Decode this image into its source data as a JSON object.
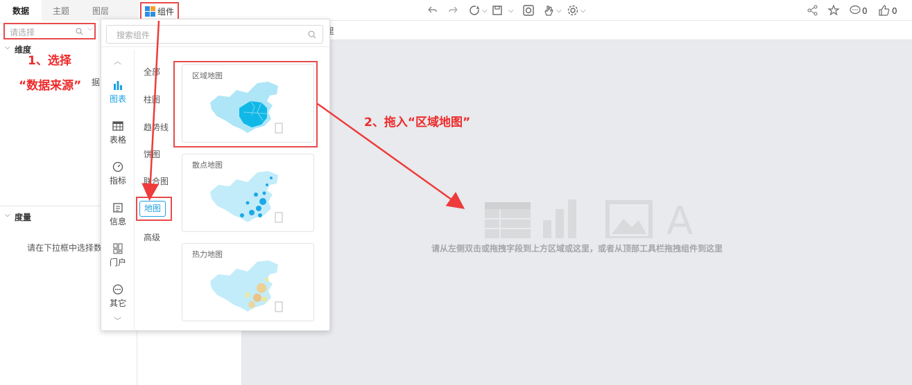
{
  "tabs": [
    {
      "label": "数据",
      "active": true
    },
    {
      "label": "主题",
      "active": false
    },
    {
      "label": "图层",
      "active": false
    }
  ],
  "component_button": {
    "label": "组件"
  },
  "toolbar": {
    "comment_count": "0",
    "like_count": "0"
  },
  "left_panel": {
    "select_placeholder": "请选择",
    "dimension_title": "维度",
    "dimension_hint_fragment": "据",
    "measure_title": "度量",
    "measure_hint": "请在下拉框中选择数"
  },
  "subbar": {
    "fragment": "里"
  },
  "popup": {
    "search_placeholder": "搜索组件",
    "categories": [
      {
        "label": "图表",
        "icon": "bar-chart-icon",
        "active": true
      },
      {
        "label": "表格",
        "icon": "table-icon",
        "active": false
      },
      {
        "label": "指标",
        "icon": "gauge-icon",
        "active": false
      },
      {
        "label": "信息",
        "icon": "info-icon",
        "active": false
      },
      {
        "label": "门户",
        "icon": "portal-icon",
        "active": false
      },
      {
        "label": "其它",
        "icon": "more-icon",
        "active": false
      }
    ],
    "subcategories": [
      "全部",
      "柱图",
      "趋势线",
      "饼图",
      "联合图",
      "地图",
      "高级"
    ],
    "active_subcategory": "地图",
    "cards": [
      {
        "title": "区域地图"
      },
      {
        "title": "散点地图"
      },
      {
        "title": "热力地图"
      }
    ]
  },
  "canvas": {
    "hint": "请从左侧双击或拖拽字段到上方区域或这里，或者从顶部工具栏拖拽组件到这里"
  },
  "annotations": {
    "step1_line1": "1、选择",
    "step1_line2": "“数据来源”",
    "step2": "2、拖入“区域地图”"
  },
  "colors": {
    "accent": "#1ba1e2",
    "annotation": "#ee2a2a",
    "map_light": "#aee6f7",
    "map_dark": "#10b8e8"
  }
}
